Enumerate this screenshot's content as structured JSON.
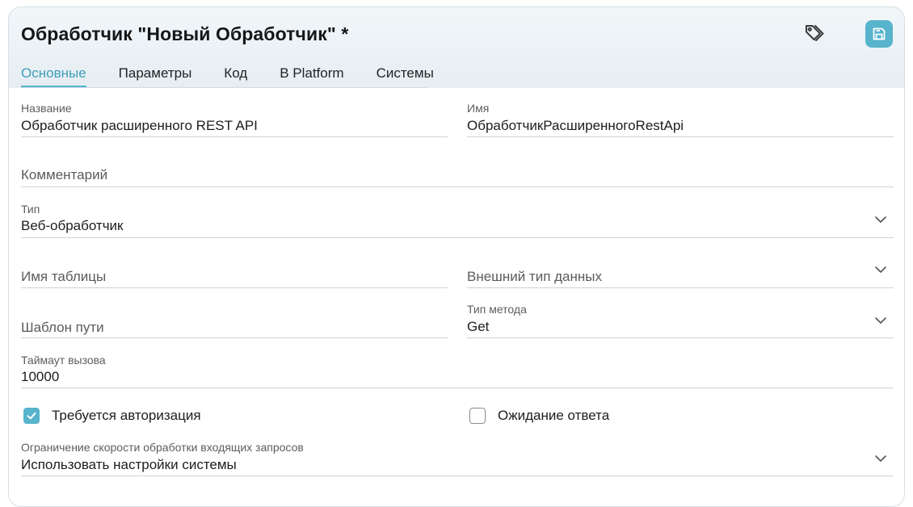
{
  "header": {
    "title": "Обработчик \"Новый Обработчик\" *",
    "tag_icon": "tags-icon",
    "save_icon": "save-icon",
    "accent": "#58b3cd"
  },
  "tabs": [
    {
      "label": "Основные",
      "active": true
    },
    {
      "label": "Параметры",
      "active": false
    },
    {
      "label": "Код",
      "active": false
    },
    {
      "label": "В Platform",
      "active": false
    },
    {
      "label": "Системы",
      "active": false
    }
  ],
  "form": {
    "name": {
      "label": "Название",
      "value": "Обработчик расширенного REST API"
    },
    "id_name": {
      "label": "Имя",
      "value": "ОбработчикРасширенногоRestApi"
    },
    "comment": {
      "placeholder": "Комментарий"
    },
    "type": {
      "label": "Тип",
      "value": "Веб-обработчик"
    },
    "table_name": {
      "placeholder": "Имя таблицы"
    },
    "external_type": {
      "placeholder": "Внешний тип данных"
    },
    "path_template": {
      "placeholder": "Шаблон пути"
    },
    "method_type": {
      "label": "Тип метода",
      "value": "Get"
    },
    "timeout": {
      "label": "Таймаут вызова",
      "value": "10000"
    },
    "auth_required": {
      "label": "Требуется авторизация",
      "checked": true
    },
    "wait_response": {
      "label": "Ожидание ответа",
      "checked": false
    },
    "rate_limit": {
      "label": "Ограничение скорости обработки входящих запросов",
      "value": "Использовать настройки системы"
    }
  }
}
